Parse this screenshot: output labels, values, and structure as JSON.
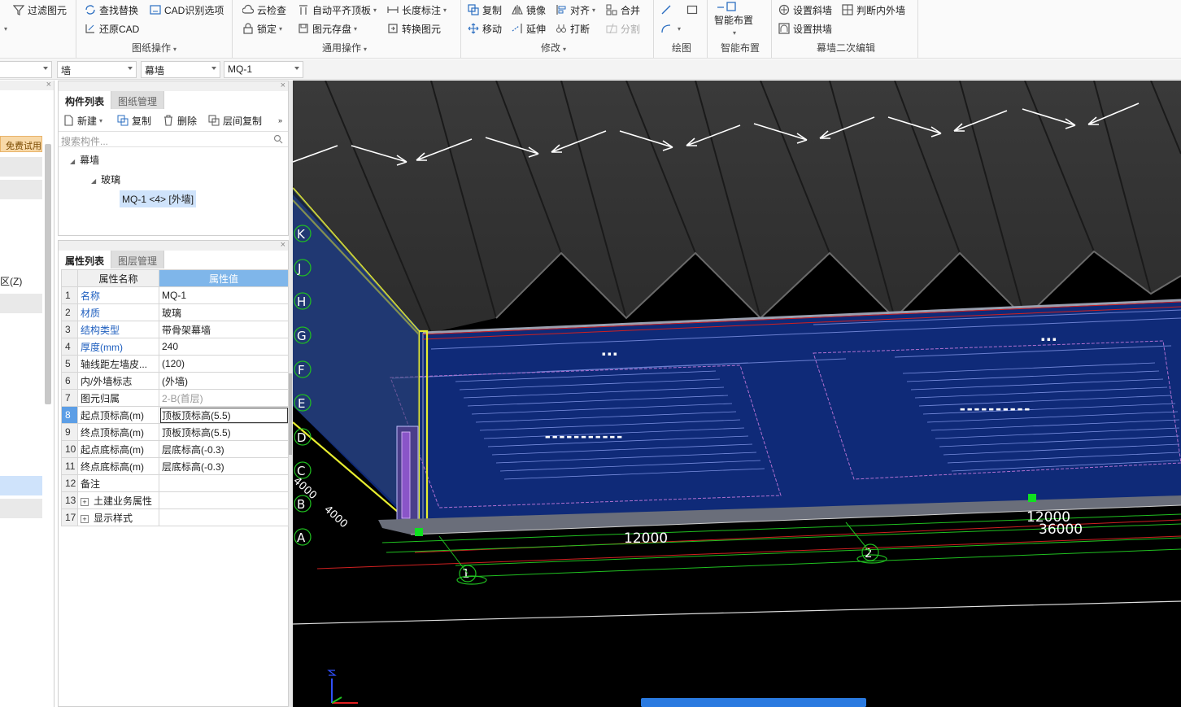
{
  "ribbon": {
    "filter_label": "过滤图元",
    "find_replace_label": "查找替换",
    "cad_options_label": "CAD识别选项",
    "restore_cad_label": "还原CAD",
    "drawing_ops_label": "图纸操作",
    "cloud_check_label": "云检查",
    "auto_slab_label": "自动平齐顶板",
    "length_mark_label": "长度标注",
    "lock_label": "锁定",
    "save_element_label": "图元存盘",
    "convert_element_label": "转换图元",
    "general_ops_label": "通用操作",
    "copy_label": "复制",
    "mirror_label": "镜像",
    "align_label": "对齐",
    "merge_label": "合并",
    "move_label": "移动",
    "extend_label": "延伸",
    "break_label": "打断",
    "split_label": "分割",
    "modify_label": "修改",
    "draw_label": "绘图",
    "smart_place_btn_label": "智能布置",
    "smart_place_label": "智能布置",
    "set_slope_wall_label": "设置斜墙",
    "judge_wall_label": "判断内外墙",
    "set_arch_wall_label": "设置拱墙",
    "curtain_edit_label": "幕墙二次编辑"
  },
  "selectors": {
    "type": "墙",
    "subtype": "幕墙",
    "element": "MQ-1"
  },
  "left_strip": {
    "trial_badge": "免费试用",
    "partial_label": "区(Z)"
  },
  "component_panel": {
    "tab_components": "构件列表",
    "tab_drawings": "图纸管理",
    "new_label": "新建",
    "copy_label": "复制",
    "delete_label": "删除",
    "floor_copy_label": "层间复制",
    "search_placeholder": "搜索构件...",
    "tree_root": "幕墙",
    "tree_child": "玻璃",
    "tree_leaf": "MQ-1 <4> [外墙]"
  },
  "property_panel": {
    "tab_properties": "属性列表",
    "tab_layers": "图层管理",
    "col_name": "属性名称",
    "col_value": "属性值",
    "rows": [
      {
        "num": "1",
        "name": "名称",
        "value": "MQ-1"
      },
      {
        "num": "2",
        "name": "材质",
        "value": "玻璃"
      },
      {
        "num": "3",
        "name": "结构类型",
        "value": "带骨架幕墙"
      },
      {
        "num": "4",
        "name": "厚度(mm)",
        "value": "240"
      },
      {
        "num": "5",
        "name": "轴线距左墙皮...",
        "value": "(120)"
      },
      {
        "num": "6",
        "name": "内/外墙标志",
        "value": "(外墙)"
      },
      {
        "num": "7",
        "name": "图元归属",
        "value": "2-B(首层)"
      },
      {
        "num": "8",
        "name": "起点顶标高(m)",
        "value": "顶板顶标高(5.5)"
      },
      {
        "num": "9",
        "name": "终点顶标高(m)",
        "value": "顶板顶标高(5.5)"
      },
      {
        "num": "10",
        "name": "起点底标高(m)",
        "value": "层底标高(-0.3)"
      },
      {
        "num": "11",
        "name": "终点底标高(m)",
        "value": "层底标高(-0.3)"
      },
      {
        "num": "12",
        "name": "备注",
        "value": ""
      },
      {
        "num": "13",
        "name": "土建业务属性",
        "value": ""
      },
      {
        "num": "17",
        "name": "显示样式",
        "value": ""
      }
    ]
  },
  "viewport": {
    "axes": [
      "K",
      "J",
      "H",
      "G",
      "F",
      "E",
      "D",
      "C",
      "B",
      "A"
    ],
    "dim_12000_left": "12000",
    "dim_12000_right": "12000",
    "dim_36000": "36000",
    "dim_4000_a": "4000",
    "dim_4000_b": "4000",
    "axis_1": "1",
    "axis_2": "2"
  }
}
